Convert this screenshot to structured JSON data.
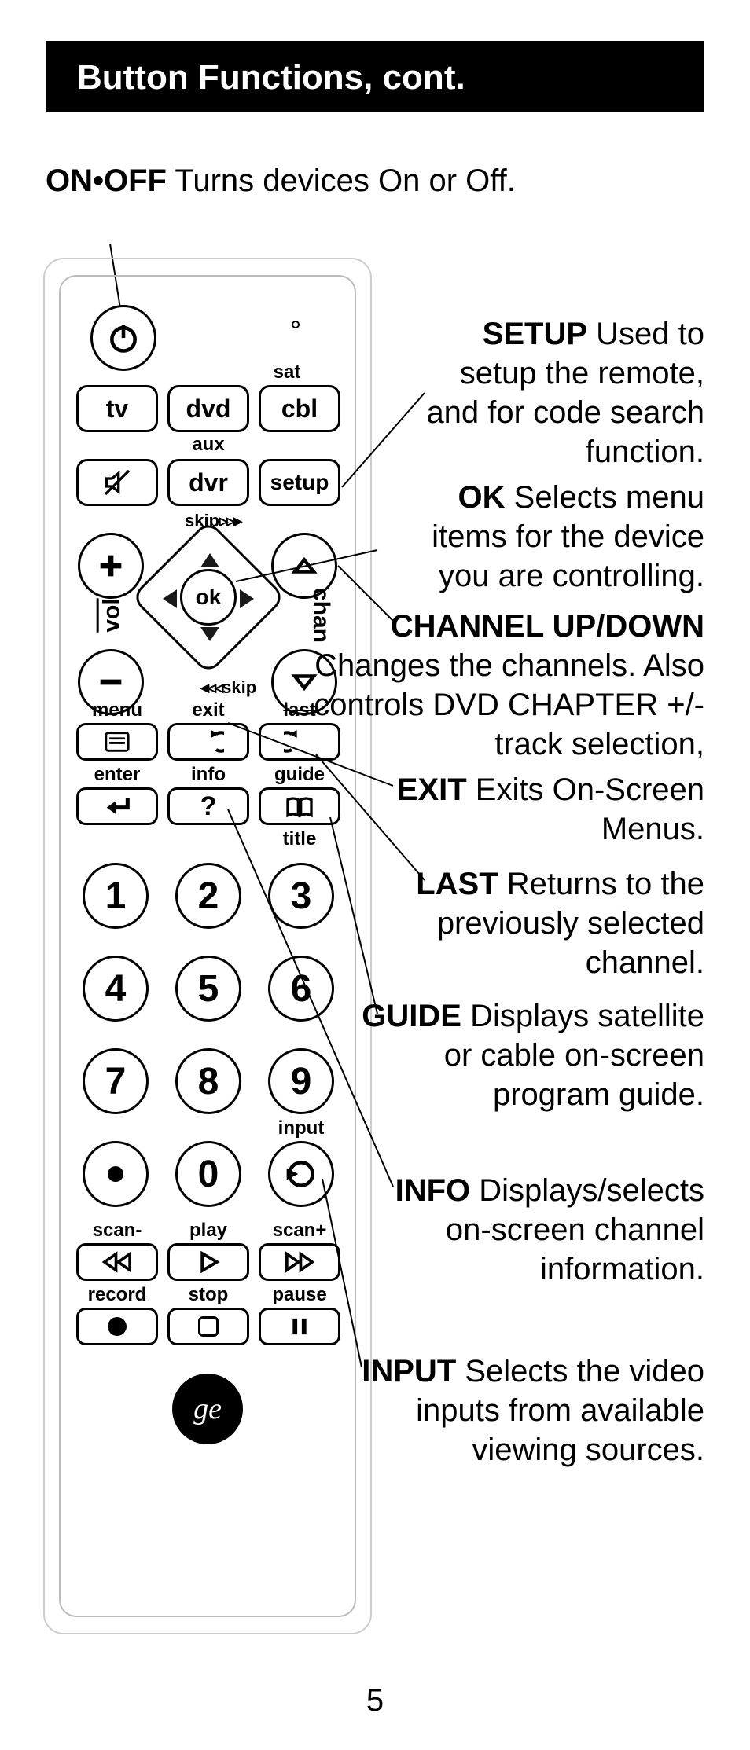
{
  "header": "Button Functions, cont.",
  "onoff": {
    "bold": "ON•OFF",
    "text": " Turns devices On or Off."
  },
  "remote": {
    "tv": "tv",
    "dvd": "dvd",
    "cbl": "cbl",
    "sat": "sat",
    "aux": "aux",
    "dvr": "dvr",
    "setup": "setup",
    "skip_fwd": "skip",
    "skip_back": "skip",
    "vol": "vol",
    "chan": "chan",
    "ok": "ok",
    "menu": "menu",
    "exit": "exit",
    "last": "last",
    "enter": "enter",
    "info": "info",
    "guide": "guide",
    "title": "title",
    "input": "input",
    "scan_minus": "scan-",
    "play": "play",
    "scan_plus": "scan+",
    "record": "record",
    "stop": "stop",
    "pause": "pause",
    "n1": "1",
    "n2": "2",
    "n3": "3",
    "n4": "4",
    "n5": "5",
    "n6": "6",
    "n7": "7",
    "n8": "8",
    "n9": "9",
    "n0": "0",
    "logo": "ge"
  },
  "desc": {
    "setup": {
      "b": "SETUP",
      "t": " Used to setup the remote, and for code search function."
    },
    "ok": {
      "b": "OK",
      "t": " Selects menu items for the device you are controlling."
    },
    "chan": {
      "b": "CHANNEL UP/DOWN",
      "t": " Changes the channels. Also controls DVD  CHAPTER +/- track selection,"
    },
    "exit": {
      "b": "EXIT",
      "t": " Exits On-Screen Menus."
    },
    "last": {
      "b": "LAST",
      "t": " Returns to the previously selected channel."
    },
    "guide": {
      "b": "GUIDE",
      "t": " Displays satellite or cable on-screen program guide."
    },
    "info": {
      "b": "INFO",
      "t": " Displays/selects on-screen channel information."
    },
    "input": {
      "b": "INPUT",
      "t": " Selects the video inputs from available viewing sources."
    }
  },
  "page": "5"
}
